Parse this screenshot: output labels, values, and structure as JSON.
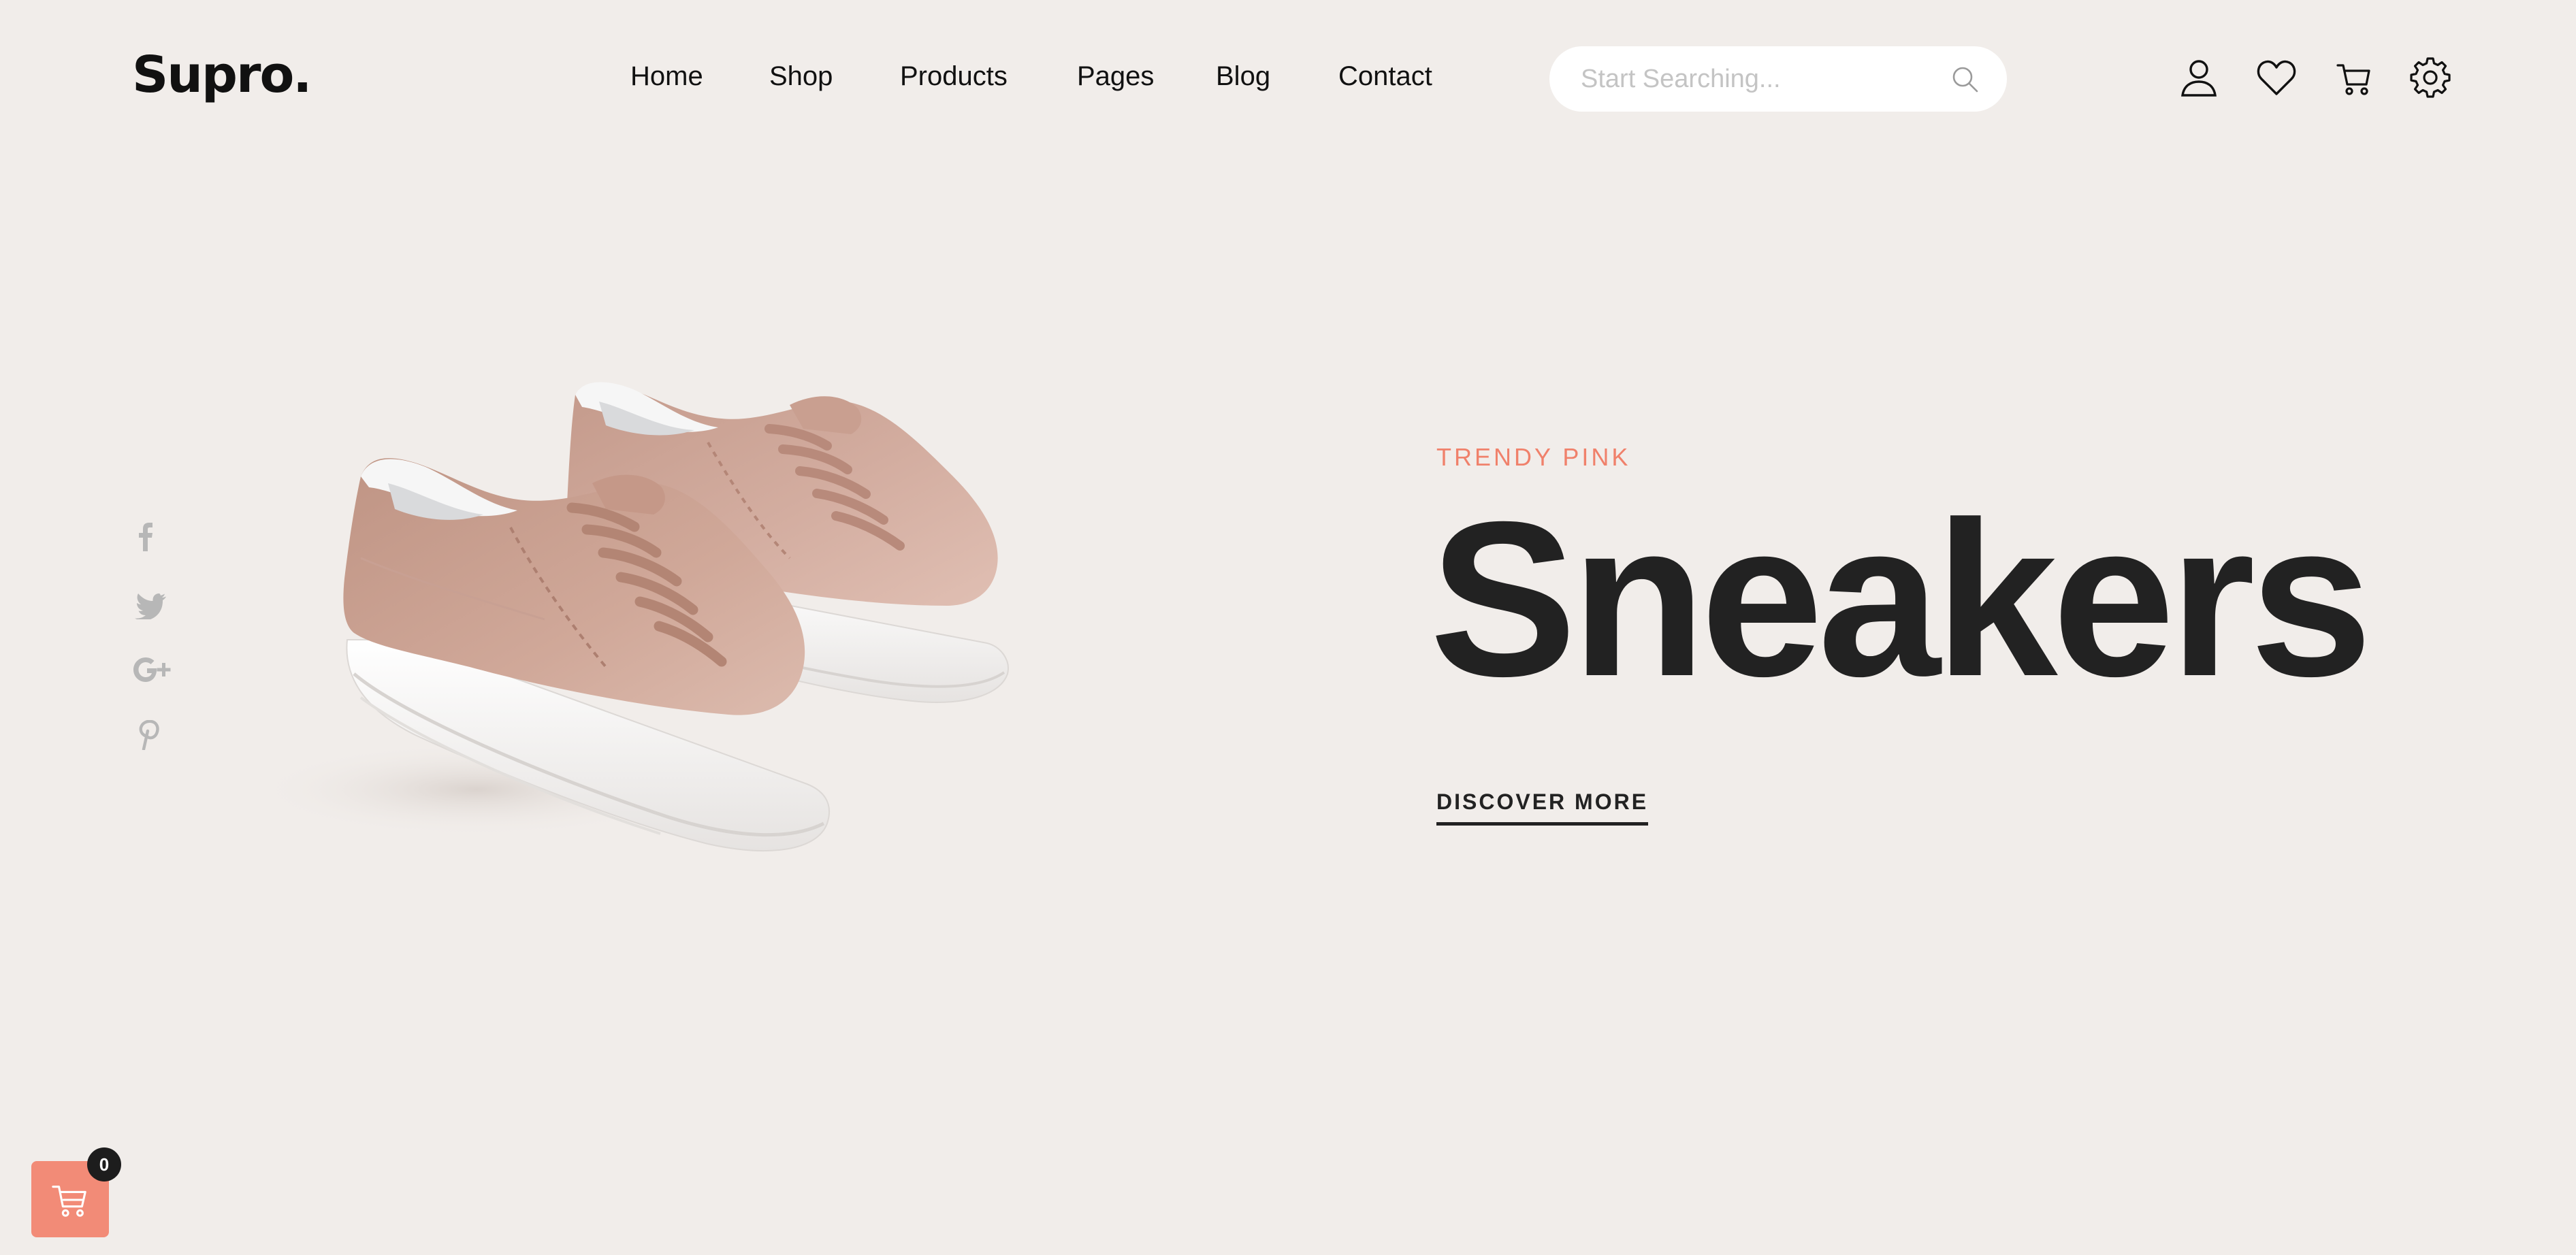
{
  "header": {
    "logo": "Supro.",
    "nav": [
      {
        "label": "Home"
      },
      {
        "label": "Shop"
      },
      {
        "label": "Products"
      },
      {
        "label": "Pages"
      },
      {
        "label": "Blog"
      },
      {
        "label": "Contact"
      }
    ],
    "search": {
      "placeholder": "Start Searching...",
      "value": "",
      "icon": "search-icon"
    },
    "icons": [
      "user-icon",
      "heart-icon",
      "cart-icon",
      "gear-icon"
    ]
  },
  "social": [
    "facebook-icon",
    "twitter-icon",
    "google-plus-icon",
    "pinterest-icon"
  ],
  "hero": {
    "subtitle": "TRENDY PINK",
    "title": "Sneakers",
    "cta": "DISCOVER MORE",
    "image": "pink-sneakers-image"
  },
  "floating_cart": {
    "count": "0",
    "icon": "cart-icon"
  },
  "colors": {
    "background": "#f1edea",
    "accent": "#f0816b",
    "cart_button": "#f28b77",
    "text": "#222222",
    "social_icons": "#b7b7b7"
  }
}
